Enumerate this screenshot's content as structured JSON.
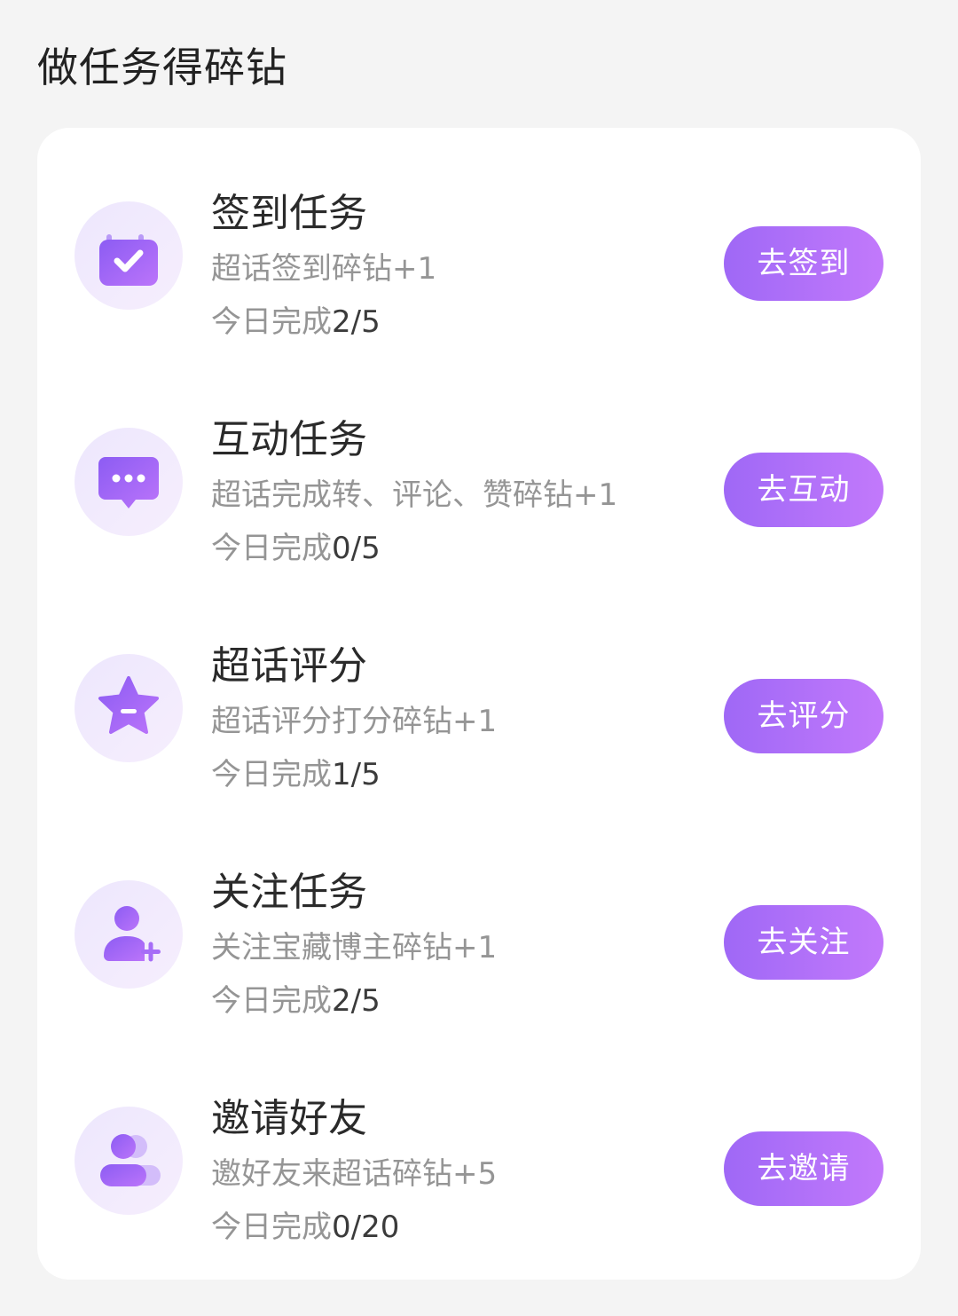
{
  "page": {
    "title": "做任务得碎钻"
  },
  "colors": {
    "accent_start": "#9f68f6",
    "accent_end": "#c279fb",
    "icon_bg": "#efe8fd",
    "title_text": "#222222",
    "secondary_text": "#959595"
  },
  "tasks": [
    {
      "icon": "calendar-check-icon",
      "title": "签到任务",
      "description": "超话签到碎钻+1",
      "progress_label": "今日完成",
      "progress_count": "2/5",
      "button": "去签到"
    },
    {
      "icon": "chat-bubble-icon",
      "title": "互动任务",
      "description": "超话完成转、评论、赞碎钻+1",
      "progress_label": "今日完成",
      "progress_count": "0/5",
      "button": "去互动"
    },
    {
      "icon": "star-icon",
      "title": "超话评分",
      "description": "超话评分打分碎钻+1",
      "progress_label": "今日完成",
      "progress_count": "1/5",
      "button": "去评分"
    },
    {
      "icon": "user-add-icon",
      "title": "关注任务",
      "description": "关注宝藏博主碎钻+1",
      "progress_label": "今日完成",
      "progress_count": "2/5",
      "button": "去关注"
    },
    {
      "icon": "users-icon",
      "title": "邀请好友",
      "description": "邀好友来超话碎钻+5",
      "progress_label": "今日完成",
      "progress_count": "0/20",
      "button": "去邀请"
    }
  ]
}
